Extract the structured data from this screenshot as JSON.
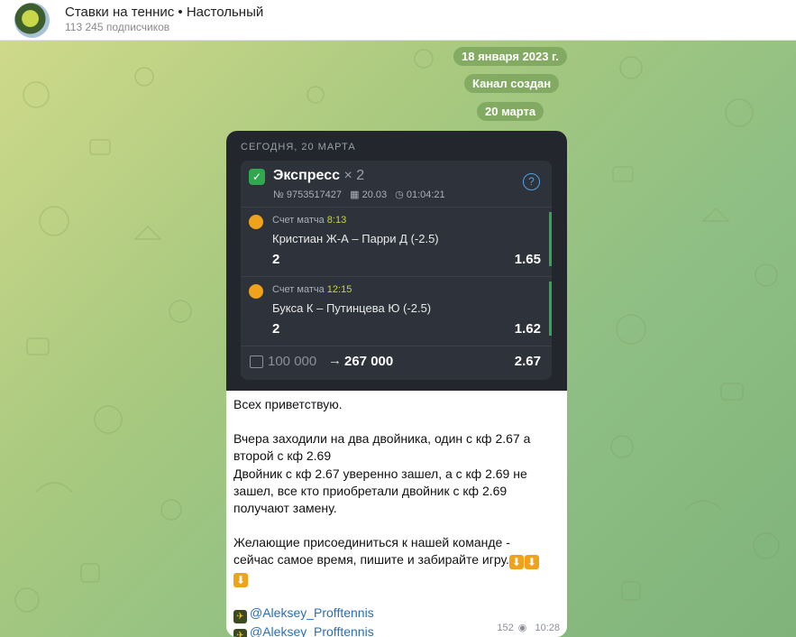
{
  "channel": {
    "title": "Ставки на теннис • Настольный",
    "subscribers": "113 245 подписчиков"
  },
  "service_messages": [
    "18 января 2023 г.",
    "Канал создан",
    "20 марта"
  ],
  "card": {
    "date_header": "СЕГОДНЯ, 20 МАРТА",
    "type": "Экспресс",
    "multiplier": "× 2",
    "number": "№ 9753517427",
    "date": "20.03",
    "time": "01:04:21",
    "bets": [
      {
        "label": "Счет матча",
        "time": "8:13",
        "match": "Кристиан Ж-А – Парри Д (-2.5)",
        "pick": "2",
        "odds": "1.65"
      },
      {
        "label": "Счет матча",
        "time": "12:15",
        "match": "Букса К – Путинцева Ю (-2.5)",
        "pick": "2",
        "odds": "1.62"
      }
    ],
    "stake": "100 000",
    "arrow": "→",
    "winnings": "267 000",
    "total_odds": "2.67"
  },
  "message": {
    "greeting": "Всех приветствую.",
    "para1_l1": "Вчера заходили на  два двойника, один с кф 2.67 а",
    "para1_l2": "второй с кф 2.69",
    "para1_l3": "Двойник с кф 2.67 уверенно зашел, а с кф 2.69 не",
    "para1_l4": "зашел, все кто приобретали  двойник с кф 2.69",
    "para1_l5": "получают замену.",
    "para2_l1": "Желающие присоединиться к нашей команде -",
    "para2_l2": "сейчас самое время, пишите и забирайте игру.",
    "link1": "@Aleksey_Profftennis",
    "link2": "@Aleksey_Profftennis",
    "views": "152",
    "time": "10:28"
  }
}
